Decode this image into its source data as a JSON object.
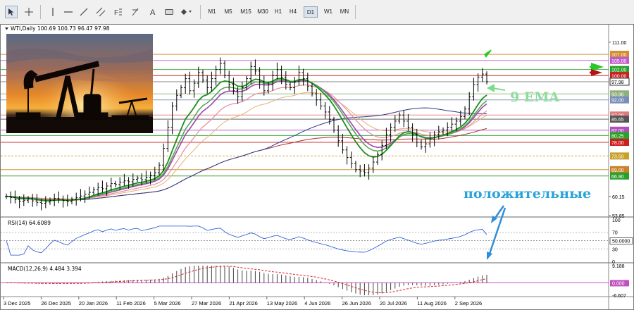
{
  "toolbar": {
    "timeframes": [
      "M1",
      "M5",
      "M15",
      "M30",
      "H1",
      "H4",
      "D1",
      "W1",
      "MN"
    ],
    "active_timeframe": "D1"
  },
  "chart_data": [
    {
      "type": "line",
      "title": "WTI,Daily  100.69 100.73 96.47 97.98",
      "price_axis_ticks": [
        "111.00",
        "60.15",
        "53.85"
      ],
      "x_tick_labels": [
        "3 Dec 2025",
        "26 Dec 2025",
        "20 Jan 2026",
        "11 Feb 2026",
        "5 Mar 2026",
        "27 Mar 2026",
        "21 Apr 2026",
        "13 May 2026",
        "4 Jun 2026",
        "26 Jun 2026",
        "20 Jul 2026",
        "11 Aug 2026",
        "2 Sep 2026"
      ],
      "ylim": [
        53.85,
        114
      ],
      "levels": [
        {
          "value": 107.0,
          "label": "107.00",
          "color": "#d28a2a"
        },
        {
          "value": 105.0,
          "label": "105.00",
          "color": "#c05cc8"
        },
        {
          "value": 102.0,
          "label": "102.00",
          "color": "#2aa02a"
        },
        {
          "value": 100.0,
          "label": "100.00",
          "color": "#cc1f1f"
        },
        {
          "value": 97.98,
          "label": "97.98",
          "color": "#333333"
        },
        {
          "value": 93.96,
          "label": "93.96",
          "color": "#8fb07a"
        },
        {
          "value": 92.0,
          "label": "92.00",
          "color": "#7a8fb8"
        },
        {
          "value": 87.0,
          "label": "87.00",
          "color": "#e07b7b"
        },
        {
          "value": 85.65,
          "label": "85.65",
          "color": "#555555"
        },
        {
          "value": 82.0,
          "label": "82.00",
          "color": "#b050c0"
        },
        {
          "value": 80.25,
          "label": "80.25",
          "color": "#2aa02a"
        },
        {
          "value": 78.0,
          "label": "78.00",
          "color": "#cc1f1f"
        },
        {
          "value": 73.5,
          "label": "73.50",
          "color": "#c8a02a"
        },
        {
          "value": 69.0,
          "label": "69.00",
          "color": "#c8842a"
        },
        {
          "value": 66.9,
          "label": "66.90",
          "color": "#2aa02a"
        }
      ],
      "annotations": [
        "9 EMA",
        "положительные"
      ],
      "price_close": [
        60.2,
        59.8,
        59.1,
        58.6,
        58.9,
        59.4,
        58.7,
        58.2,
        57.9,
        58.3,
        58.9,
        59.5,
        59.2,
        58.8,
        58.5,
        59.1,
        59.8,
        60.3,
        60.9,
        61.5,
        62.4,
        63.1,
        62.7,
        63.6,
        64.4,
        64.1,
        64.9,
        65.3,
        65.0,
        65.8,
        66.2,
        65.7,
        66.4,
        67.1,
        68.0,
        70.5,
        76.0,
        83.0,
        90.0,
        93.5,
        96.0,
        99.0,
        95.0,
        97.5,
        101.0,
        98.5,
        96.0,
        99.0,
        102.0,
        104.0,
        100.0,
        97.0,
        95.0,
        93.0,
        96.0,
        99.0,
        103.0,
        101.5,
        98.0,
        95.0,
        97.0,
        100.0,
        102.0,
        99.5,
        97.0,
        96.0,
        98.0,
        101.0,
        99.0,
        96.5,
        94.0,
        92.0,
        90.0,
        88.0,
        85.5,
        82.0,
        78.5,
        75.5,
        73.0,
        71.0,
        69.0,
        68.5,
        68.0,
        69.5,
        71.5,
        74.0,
        77.0,
        80.5,
        83.0,
        85.0,
        87.0,
        85.0,
        83.0,
        80.5,
        78.0,
        76.5,
        77.5,
        79.0,
        80.5,
        81.5,
        82.0,
        83.0,
        84.0,
        85.0,
        86.5,
        89.0,
        93.0,
        97.0,
        99.5,
        100.5,
        98.0
      ],
      "rsi": {
        "label": "RSI(14) 64.6089",
        "ticks": [
          "100",
          "70",
          "50.0000",
          "30",
          "0"
        ],
        "current": 64.6089
      },
      "macd": {
        "label": "MACD(12,26,9) 4.484 3.394",
        "ticks": [
          "9.188",
          "0.000",
          "-6.607"
        ],
        "main": 4.484,
        "signal": 3.394
      }
    }
  ],
  "colors": {
    "price": "#000000",
    "ema9": "#1a8f1a",
    "ema_short": "#5aa85a",
    "ema_mid": "#a045b0",
    "ema_long_pink": "#e88aa0",
    "ema_long_orange": "#e8b070",
    "sma_blue": "#2b3a8a",
    "sma_red": "#b03030",
    "annotation_blue": "#29a3d8"
  },
  "icons": [
    "cursor-arrow-icon",
    "crosshair-icon",
    "vertical-line-icon",
    "horizontal-line-icon",
    "trend-line-icon",
    "equidistant-channel-icon",
    "fibonacci-icon",
    "text-label-icon",
    "text-icon",
    "label-rect-icon",
    "shapes-dropdown-icon"
  ]
}
